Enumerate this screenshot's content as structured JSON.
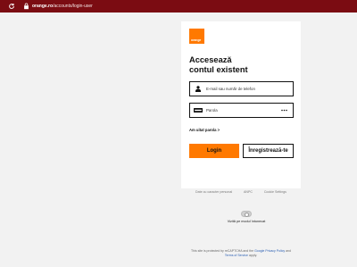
{
  "browser": {
    "url_domain": "orange.ro",
    "url_path": "/accounts/login-user"
  },
  "logo": {
    "text": "orange",
    "color": "#ff7900"
  },
  "form": {
    "title_line1": "Accesează",
    "title_line2": "contul existent",
    "email_placeholder": "E-mail sau număr de telefon",
    "password_placeholder": "Parola",
    "forgot_password": "Am uitat parola >",
    "login_button": "Login",
    "register_button": "Înregistrează-te"
  },
  "footer": {
    "links": [
      "Date cu caracter personal",
      "ANPC",
      "Cookie Settings"
    ],
    "dark_mode_label": "Vizită pe modul întunecat",
    "recaptcha": {
      "prefix": "This site is protected by reCAPTCHA and the",
      "privacy_link": "Google Privacy Policy",
      "middle": "and",
      "terms_link": "Terms of Service",
      "suffix": "apply."
    }
  },
  "colors": {
    "accent": "#ff7900",
    "topbar": "#7b0c12",
    "background": "#f2f2f2"
  }
}
